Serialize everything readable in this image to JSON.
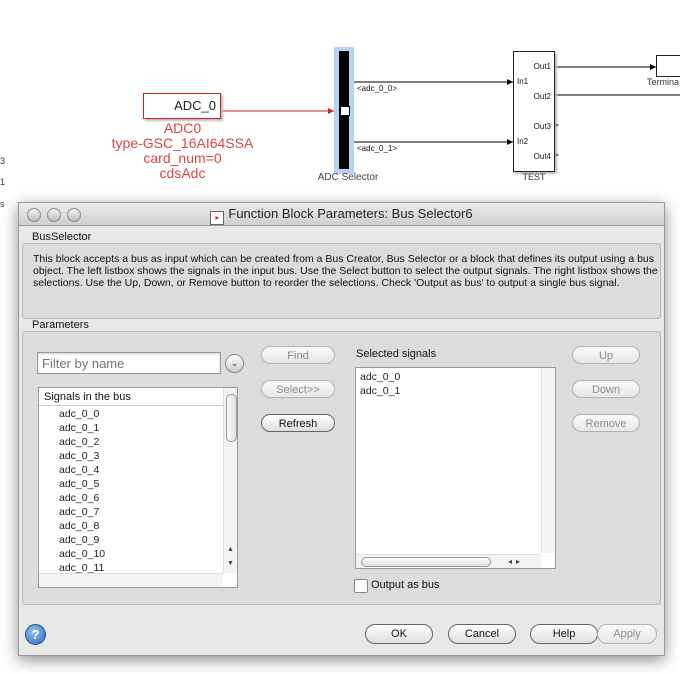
{
  "canvas": {
    "edge_texts": [
      "3",
      "1",
      "s"
    ],
    "adc_block_name": "ADC_0",
    "adc_labels": [
      "ADC0",
      "type-GSC_16AI64SSA",
      "card_num=0",
      "cdsAdc"
    ],
    "selector_name": "ADC Selector",
    "signal_labels": [
      "<adc_0_0>",
      "<adc_0_1>"
    ],
    "test_block_name": "TEST",
    "test_inputs": [
      "In1",
      "In2"
    ],
    "test_outputs": [
      "Out1",
      "Out2",
      "Out3",
      "Out4"
    ],
    "terminator_name": "Termina"
  },
  "dialog": {
    "title": "Function Block Parameters: Bus Selector6",
    "block_section_label": "BusSelector",
    "description": "This block accepts a bus as input which can be created from a Bus Creator, Bus Selector or a block that defines its output using a bus object. The left listbox shows the signals in the input bus. Use the Select button to select the output signals. The right listbox shows the selections. Use the Up, Down, or Remove button to reorder the selections. Check 'Output as bus' to output a single bus signal.",
    "parameters_label": "Parameters",
    "filter_placeholder": "Filter by name",
    "signals_header": "Signals in the bus",
    "signals": [
      "adc_0_0",
      "adc_0_1",
      "adc_0_2",
      "adc_0_3",
      "adc_0_4",
      "adc_0_5",
      "adc_0_6",
      "adc_0_7",
      "adc_0_8",
      "adc_0_9",
      "adc_0_10",
      "adc_0_11"
    ],
    "buttons": {
      "find": "Find",
      "select": "Select>>",
      "refresh": "Refresh",
      "up": "Up",
      "down": "Down",
      "remove": "Remove",
      "ok": "OK",
      "cancel": "Cancel",
      "help": "Help",
      "apply": "Apply"
    },
    "selected_signals_label": "Selected signals",
    "selected_signals": [
      "adc_0_0",
      "adc_0_1"
    ],
    "output_as_bus_label": "Output as bus",
    "output_as_bus_checked": false,
    "help_icon_glyph": "?"
  }
}
